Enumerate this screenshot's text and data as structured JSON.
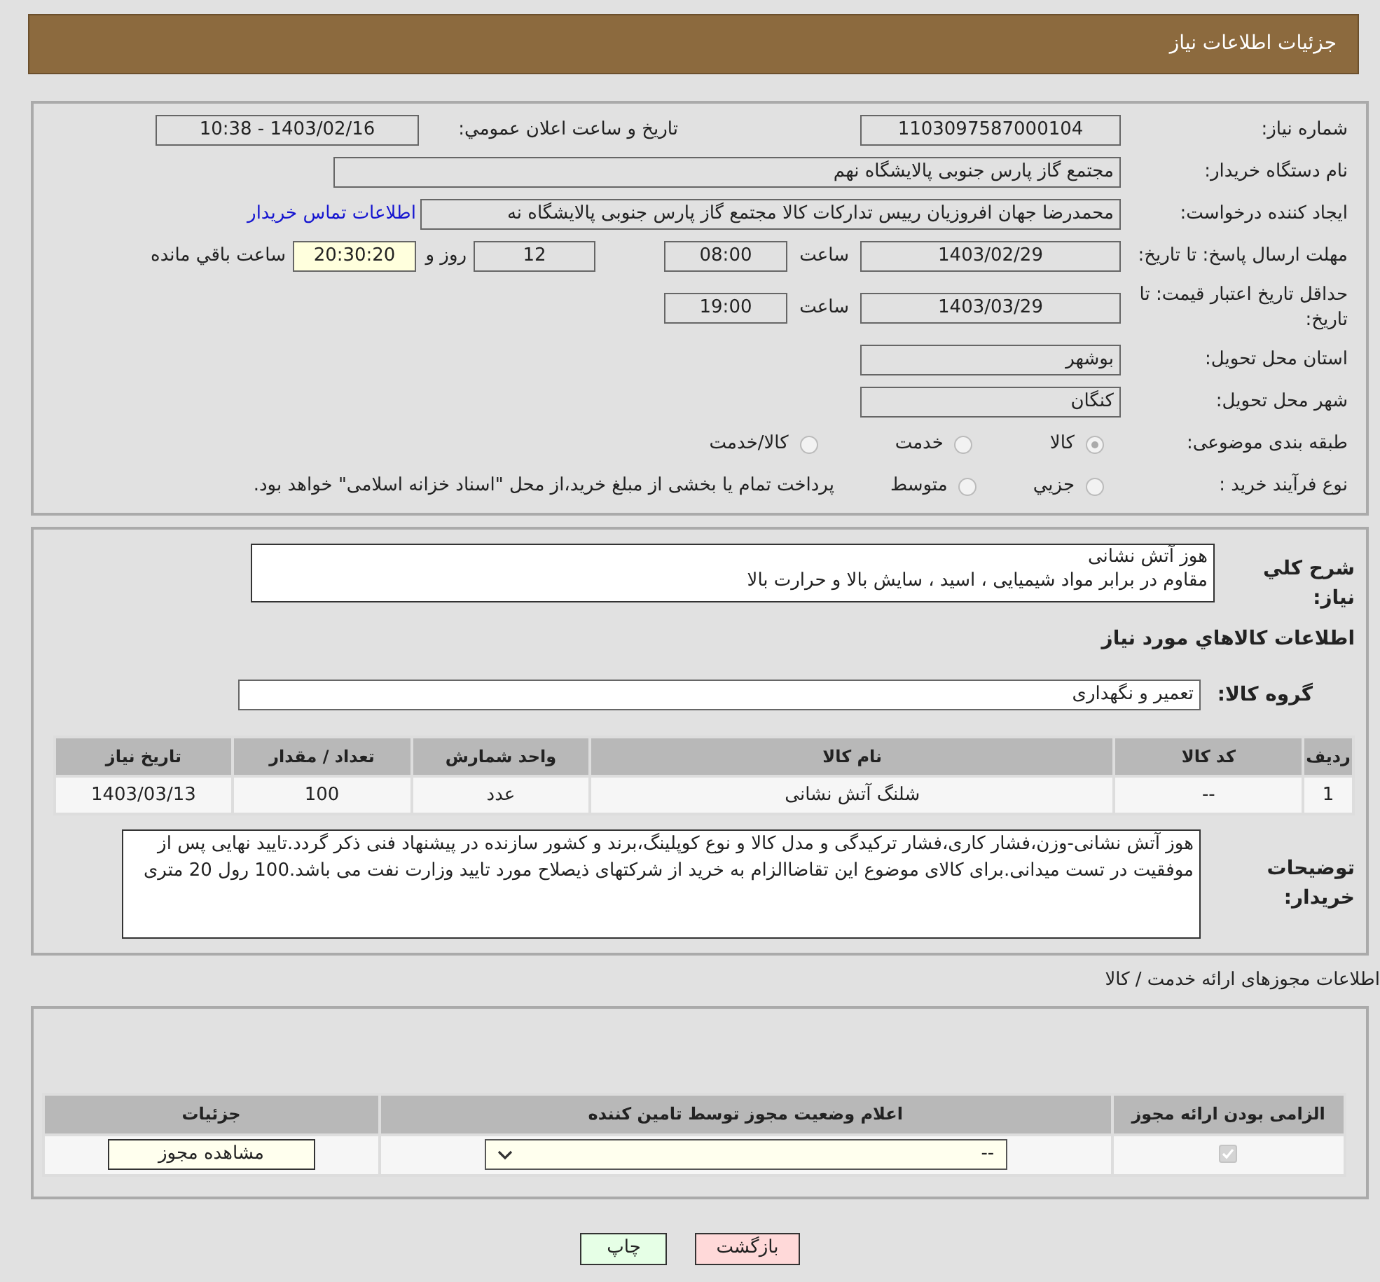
{
  "header": {
    "title": "جزئیات اطلاعات نیاز"
  },
  "need_info": {
    "need_number": {
      "label": "شماره نیاز:",
      "value": "1103097587000104"
    },
    "announce_datetime": {
      "label": "تاریخ و ساعت اعلان عمومي:",
      "value": "1403/02/16 - 10:38"
    },
    "buyer_org": {
      "label": "نام دستگاه خریدار:",
      "value": "مجتمع گاز پارس جنوبی  پالایشگاه نهم"
    },
    "requester": {
      "label": "ایجاد کننده درخواست:",
      "value": "محمدرضا جهان افروزیان رییس تدارکات کالا مجتمع گاز پارس جنوبی  پالایشگاه نه",
      "link": "اطلاعات تماس خریدار"
    },
    "response_deadline": {
      "label": "مهلت ارسال پاسخ: تا تاریخ:",
      "date": "1403/02/29",
      "time_label": "ساعت",
      "time": "08:00",
      "days": "12",
      "days_label": "روز و",
      "remaining": "20:30:20",
      "remaining_label": "ساعت باقي مانده"
    },
    "price_validity": {
      "label": "حداقل تاریخ اعتبار قیمت: تا تاریخ:",
      "date": "1403/03/29",
      "time_label": "ساعت",
      "time": "19:00"
    },
    "province": {
      "label": "استان محل تحویل:",
      "value": "بوشهر"
    },
    "city": {
      "label": "شهر محل تحویل:",
      "value": "کنگان"
    },
    "category": {
      "label": "طبقه بندی موضوعی:",
      "options": [
        {
          "label": "کالا",
          "selected": true
        },
        {
          "label": "خدمت",
          "selected": false
        },
        {
          "label": "کالا/خدمت",
          "selected": false
        }
      ]
    },
    "purchase_process": {
      "label": "نوع فرآیند خرید :",
      "options": [
        {
          "label": "جزيي",
          "selected": false
        },
        {
          "label": "متوسط",
          "selected": false
        }
      ],
      "note": "پرداخت تمام یا بخشی از مبلغ خرید،از محل \"اسناد خزانه اسلامی\" خواهد بود."
    }
  },
  "goods": {
    "description": {
      "label": "شرح کلي نیاز:",
      "lines": [
        "هوز آتش نشانی",
        "مقاوم در برابر مواد شیمیایی ، اسید ، سایش بالا و حرارت بالا"
      ]
    },
    "section_title": "اطلاعات کالاهاي مورد نیاز",
    "group": {
      "label": "گروه کالا:",
      "value": "تعمیر و نگهداری"
    },
    "table": {
      "columns": [
        "رديف",
        "کد کالا",
        "نام کالا",
        "واحد شمارش",
        "تعداد / مقدار",
        "تاریخ نیاز"
      ],
      "rows": [
        [
          "1",
          "--",
          "شلنگ آتش نشانی",
          "عدد",
          "100",
          "1403/03/13"
        ]
      ]
    },
    "buyer_notes": {
      "label": "توضیحات خریدار:",
      "value": "هوز آتش نشانی-وزن،فشار کاری،فشار ترکیدگی و مدل کالا و نوع کوپلینگ،برند و کشور سازنده در پیشنهاد فنی ذکر گردد.تایید نهایی پس از موفقیت در تست میدانی.برای کالای موضوع این تقاضاالزام به خرید از شرکتهای ذیصلاح مورد تایید وزارت نفت می باشد.100 رول 20 متری"
    }
  },
  "permits": {
    "title": "اطلاعات مجوزهای ارائه خدمت / کالا",
    "columns": [
      "الزامی بودن ارائه مجوز",
      "اعلام وضعیت مجوز توسط تامین کننده",
      "جزئیات"
    ],
    "rows": [
      {
        "required": true,
        "status": "--",
        "details_button": "مشاهده مجوز"
      }
    ]
  },
  "buttons": [
    {
      "kind": "back",
      "label": "بازگشت"
    },
    {
      "kind": "print",
      "label": "چاپ"
    }
  ]
}
